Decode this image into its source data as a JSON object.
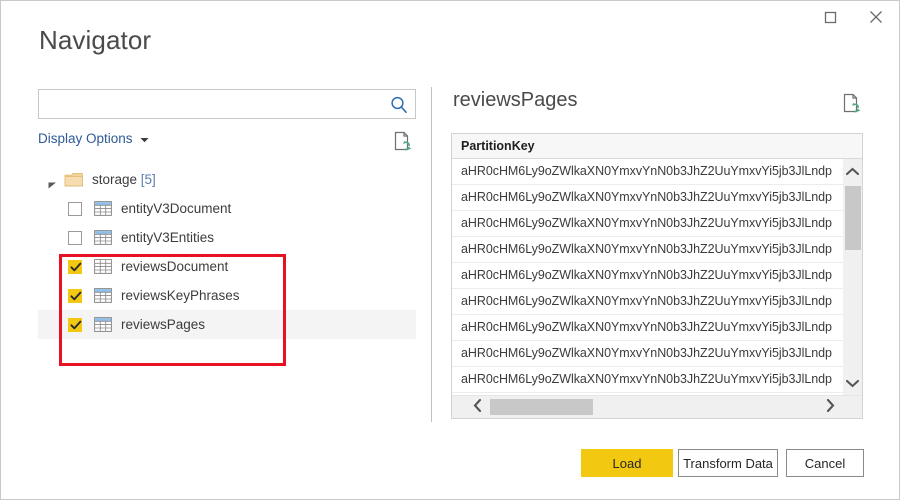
{
  "window": {
    "title": "Navigator",
    "maximize_icon": "maximize-icon",
    "close_icon": "close-icon"
  },
  "left_pane": {
    "search": {
      "value": "",
      "placeholder": "",
      "icon": "search-icon"
    },
    "display_options": {
      "label": "Display Options",
      "chevron_icon": "chevron-down-icon"
    },
    "refresh_icon": "refresh-document-icon",
    "tree": {
      "root": {
        "label": "storage",
        "count": "[5]",
        "expander_icon": "expander-triangle-icon",
        "folder_icon": "folder-icon",
        "expanded": true
      },
      "items": [
        {
          "label": "entityV3Document",
          "checked": false,
          "selected": false,
          "icon": "table-icon"
        },
        {
          "label": "entityV3Entities",
          "checked": false,
          "selected": false,
          "icon": "table-icon"
        },
        {
          "label": "reviewsDocument",
          "checked": true,
          "selected": false,
          "icon": "table-icon"
        },
        {
          "label": "reviewsKeyPhrases",
          "checked": true,
          "selected": false,
          "icon": "table-icon"
        },
        {
          "label": "reviewsPages",
          "checked": true,
          "selected": true,
          "icon": "table-icon"
        }
      ]
    },
    "annotation": {
      "shape": "rectangle",
      "color": "#e81123",
      "highlights": [
        "reviewsDocument",
        "reviewsKeyPhrases",
        "reviewsPages"
      ]
    }
  },
  "right_pane": {
    "preview_title": "reviewsPages",
    "refresh_icon": "refresh-document-icon",
    "grid": {
      "columns": [
        "PartitionKey"
      ],
      "rows": [
        [
          "aHR0cHM6Ly9oZWlkaXN0YmxvYnN0b3JhZ2UuYmxvYi5jb3JlLndp"
        ],
        [
          "aHR0cHM6Ly9oZWlkaXN0YmxvYnN0b3JhZ2UuYmxvYi5jb3JlLndp"
        ],
        [
          "aHR0cHM6Ly9oZWlkaXN0YmxvYnN0b3JhZ2UuYmxvYi5jb3JlLndp"
        ],
        [
          "aHR0cHM6Ly9oZWlkaXN0YmxvYnN0b3JhZ2UuYmxvYi5jb3JlLndp"
        ],
        [
          "aHR0cHM6Ly9oZWlkaXN0YmxvYnN0b3JhZ2UuYmxvYi5jb3JlLndp"
        ],
        [
          "aHR0cHM6Ly9oZWlkaXN0YmxvYnN0b3JhZ2UuYmxvYi5jb3JlLndp"
        ],
        [
          "aHR0cHM6Ly9oZWlkaXN0YmxvYnN0b3JhZ2UuYmxvYi5jb3JlLndp"
        ],
        [
          "aHR0cHM6Ly9oZWlkaXN0YmxvYnN0b3JhZ2UuYmxvYi5jb3JlLndp"
        ],
        [
          "aHR0cHM6Ly9oZWlkaXN0YmxvYnN0b3JhZ2UuYmxvYi5jb3JlLndp"
        ]
      ]
    },
    "vertical_scrollbar": {
      "up_icon": "chevron-up-icon",
      "down_icon": "chevron-down-icon"
    },
    "horizontal_scrollbar": {
      "left_icon": "chevron-left-icon",
      "right_icon": "chevron-right-icon"
    }
  },
  "footer": {
    "load_label": "Load",
    "transform_label": "Transform Data",
    "cancel_label": "Cancel",
    "accent_color": "#f2c811"
  }
}
